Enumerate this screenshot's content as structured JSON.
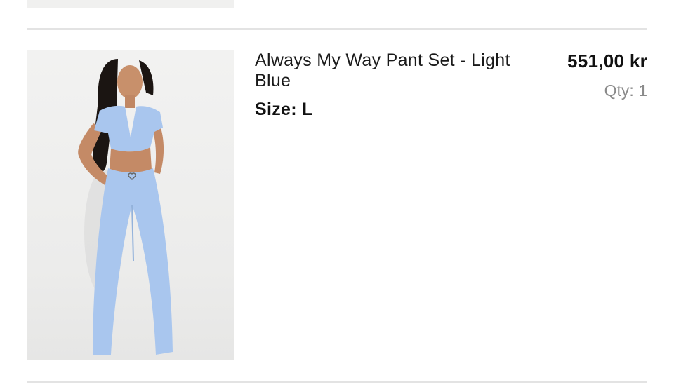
{
  "cart_item": {
    "name": "Always My Way Pant Set - Light Blue",
    "size_label": "Size: L",
    "price": "551,00 kr",
    "quantity": "Qty: 1",
    "image_icon": "product-photo",
    "image_color": "#a9c6ee"
  }
}
